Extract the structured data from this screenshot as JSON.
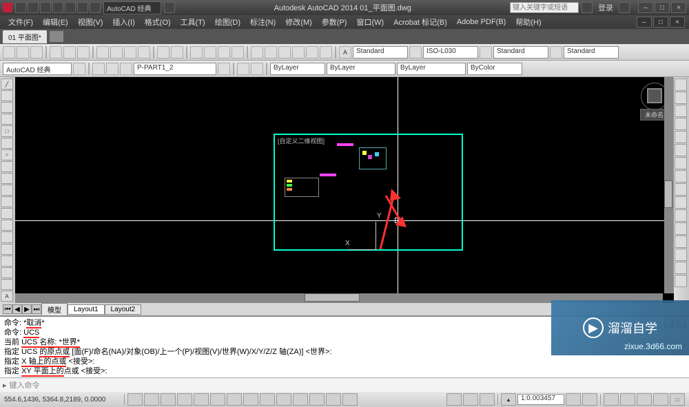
{
  "app": {
    "title_center": "Autodesk AutoCAD 2014   01_平面图.dwg",
    "workspace": "AutoCAD 经典",
    "search_placeholder": "键入关键字或短语",
    "login": "登录"
  },
  "menu": {
    "items": [
      "文件(F)",
      "编辑(E)",
      "视图(V)",
      "插入(I)",
      "格式(O)",
      "工具(T)",
      "绘图(D)",
      "标注(N)",
      "修改(M)",
      "参数(P)",
      "窗口(W)",
      "Acrobat 标记(B)",
      "Adobe PDF(B)",
      "帮助(H)"
    ]
  },
  "docTabs": {
    "active": "01 平面图*"
  },
  "tb1": {
    "workspace": "AutoCAD 经典",
    "layer": "P-PART1_2",
    "by_layer": "ByLayer",
    "linetype": "ByLayer",
    "lineweight": "ByLayer",
    "color": "ByColor"
  },
  "tb_top": {
    "standard1": "Standard",
    "iso": "ISO-L030",
    "standard2": "Standard",
    "standard3": "Standard"
  },
  "viewport": {
    "label": "[自定义二维视图]",
    "nav_label": "未命名"
  },
  "ucs": {
    "x": "X",
    "y": "Y"
  },
  "layoutTabs": {
    "model": "模型",
    "l1": "Layout1",
    "l2": "Layout2"
  },
  "cmd": {
    "l1_a": "命令: *",
    "l1_b": "取消",
    "l1_c": "*",
    "l2_a": "命令: ",
    "l2_b": "UCS",
    "l3_a": "当前 ",
    "l3_b": "UCS 名称: *世界*",
    "l4_a": "指定 UCS ",
    "l4_b": "的原点或",
    "l4_c": " [面(F)/命名(NA)/对象(OB)/上一个(P)/视图(V)/世界(W)/X/Y/Z/Z 轴(ZA)] <世界>:",
    "l5_a": "指定 ",
    "l5_b": "X 轴上的点或",
    "l5_c": " <接受>:",
    "l6_a": "指定 ",
    "l6_b": "XY 平面上的",
    "l6_c": "点或 <接受>:",
    "prompt_placeholder": "键入命令"
  },
  "status": {
    "coords": "554.6,1436, 5364.8,2189, 0.0000",
    "scale": "1:0.003457"
  },
  "watermark": {
    "main": "溜溜自学",
    "sub": "zixue.3d66.com"
  }
}
